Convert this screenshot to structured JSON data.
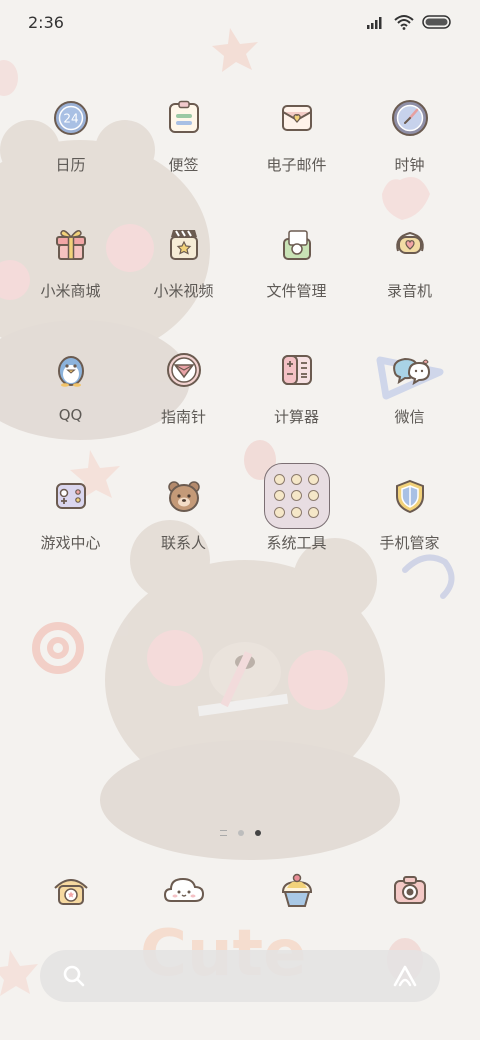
{
  "status_bar": {
    "time": "2:36",
    "icons": [
      "signal-icon",
      "wifi-icon",
      "battery-icon"
    ]
  },
  "apps": [
    {
      "label": "日历",
      "icon": "calendar-icon",
      "badge": "24"
    },
    {
      "label": "便签",
      "icon": "notes-icon"
    },
    {
      "label": "电子邮件",
      "icon": "email-icon"
    },
    {
      "label": "时钟",
      "icon": "clock-icon"
    },
    {
      "label": "小米商城",
      "icon": "gift-icon"
    },
    {
      "label": "小米视频",
      "icon": "video-icon"
    },
    {
      "label": "文件管理",
      "icon": "file-manager-icon"
    },
    {
      "label": "录音机",
      "icon": "recorder-icon"
    },
    {
      "label": "QQ",
      "icon": "qq-penguin-icon"
    },
    {
      "label": "指南针",
      "icon": "compass-icon"
    },
    {
      "label": "计算器",
      "icon": "calculator-icon"
    },
    {
      "label": "微信",
      "icon": "wechat-icon"
    },
    {
      "label": "游戏中心",
      "icon": "gamepad-icon"
    },
    {
      "label": "联系人",
      "icon": "bear-contacts-icon"
    },
    {
      "label": "系统工具",
      "icon": "folder-icon"
    },
    {
      "label": "手机管家",
      "icon": "shield-icon"
    }
  ],
  "page_indicator": {
    "pages": 3,
    "active": 2
  },
  "dock": [
    {
      "icon": "phone-icon"
    },
    {
      "icon": "cloud-messages-icon"
    },
    {
      "icon": "cupcake-browser-icon"
    },
    {
      "icon": "camera-icon"
    }
  ],
  "search_bar": {
    "left_icon": "search-icon",
    "right_icon": "assistant-icon"
  },
  "colors": {
    "background": "#f4f2ef",
    "text": "#5e5a56",
    "outline": "#6b5b50"
  },
  "wallpaper_text": "Cute"
}
